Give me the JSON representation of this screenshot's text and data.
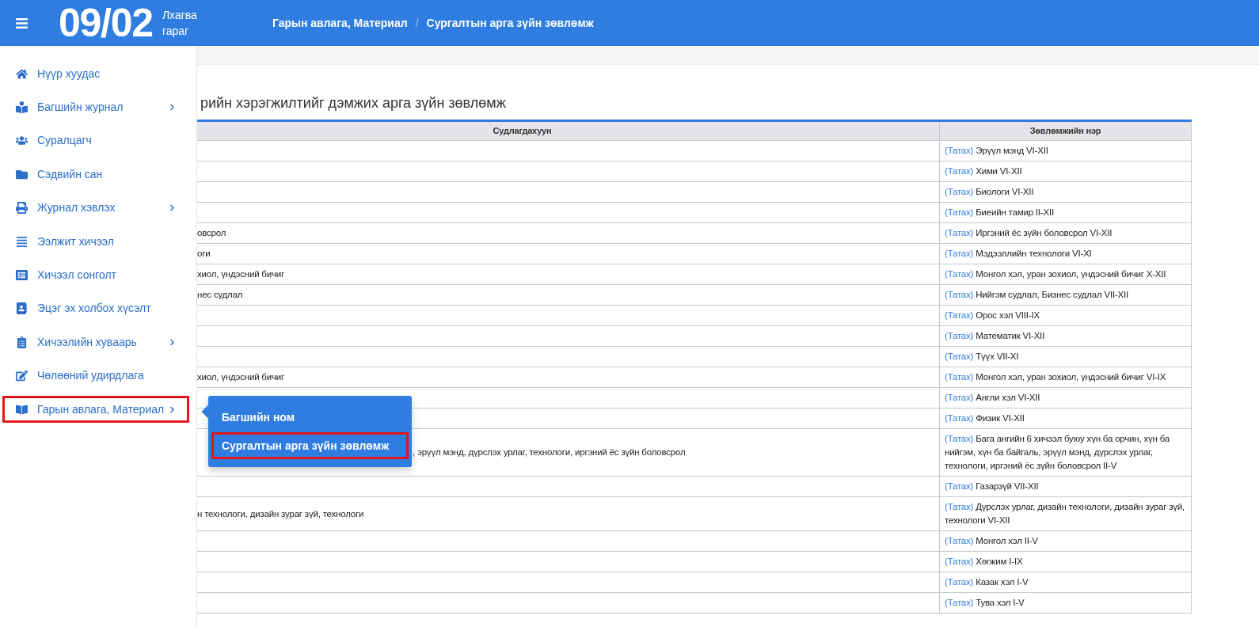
{
  "header": {
    "date": "09/02",
    "weekday_line1": "Лхагва",
    "weekday_line2": "гараг",
    "breadcrumb": [
      "Гарын авлага, Материал",
      "Сургалтын арга зүйн зөвлөмж"
    ],
    "breadcrumb_separator": "/"
  },
  "sidebar": {
    "items": [
      {
        "label": "Нүүр хуудас",
        "has_submenu": false,
        "highlighted": false
      },
      {
        "label": "Багшийн журнал",
        "has_submenu": true,
        "highlighted": false
      },
      {
        "label": "Суралцагч",
        "has_submenu": false,
        "highlighted": false
      },
      {
        "label": "Сэдвийн сан",
        "has_submenu": false,
        "highlighted": false
      },
      {
        "label": "Журнал хэвлэх",
        "has_submenu": true,
        "highlighted": false
      },
      {
        "label": "Ээлжит хичээл",
        "has_submenu": false,
        "highlighted": false
      },
      {
        "label": "Хичээл сонголт",
        "has_submenu": false,
        "highlighted": false
      },
      {
        "label": "Эцэг эх холбох хүсэлт",
        "has_submenu": false,
        "highlighted": false
      },
      {
        "label": "Хичээлийн хуваарь",
        "has_submenu": true,
        "highlighted": false
      },
      {
        "label": "Чөлөөний удирдлага",
        "has_submenu": false,
        "highlighted": false
      },
      {
        "label": "Гарын авлага, Материал",
        "has_submenu": true,
        "highlighted": true
      }
    ]
  },
  "submenu": {
    "items": [
      {
        "label": "Багшийн ном",
        "highlighted": false
      },
      {
        "label": "Сургалтын арга зүйн зөвлөмж",
        "highlighted": true
      }
    ]
  },
  "page_title": "рийн хэрэгжилтийг дэмжих арга зүйн зөвлөмж",
  "table": {
    "columns": [
      "Судлагдахуун",
      "Зөвлөмжийн нэр"
    ],
    "rows": [
      {
        "link": "(Татах)",
        "name": "Эрүүл мэнд VI-XII"
      },
      {
        "link": "(Татах)",
        "name": "Хими VI-XII"
      },
      {
        "link": "(Татах)",
        "name": "Биологи VI-XII"
      },
      {
        "link": "(Татах)",
        "name": "Биеийн тамир II-XII"
      },
      {
        "subject": "овсрол",
        "link": "(Татах)",
        "name": "Иргэний ёс зүйн боловсрол VI-XII"
      },
      {
        "subject": "оги",
        "link": "(Татах)",
        "name": "Мэдээллийн технологи VI-XI"
      },
      {
        "subject": "хиол, үндэсний бичиг",
        "link": "(Татах)",
        "name": "Монгол хэл, уран зохиол, үндэсний бичиг X-XII"
      },
      {
        "subject": "нес судлал",
        "link": "(Татах)",
        "name": "Нийгэм судлал, Бизнес судлал VII-XII"
      },
      {
        "link": "(Татах)",
        "name": "Орос хэл VIII-IX"
      },
      {
        "link": "(Татах)",
        "name": "Математик VI-XII"
      },
      {
        "link": "(Татах)",
        "name": "Түүх VII-XI"
      },
      {
        "subject": "хиол, үндэсний бичиг",
        "link": "(Татах)",
        "name": "Монгол хэл, уран зохиол, үндэсний бичиг VI-IX"
      },
      {
        "link": "(Татах)",
        "name": "Англи хэл VI-XII"
      },
      {
        "link": "(Татах)",
        "name": "Физик VI-XII"
      },
      {
        "subject": ", эрүүл мэнд, дүрслэх урлаг, технологи, иргэний ёс зүйн боловсрол",
        "subject_covered": true,
        "link": "(Татах)",
        "name": "Бага ангийн 6 хичээл буюу хүн ба орчин, хүн ба нийгэм, хүн ба байгаль, эрүүл мэнд, дүрслэх урлаг, технологи, иргэний ёс зүйн боловсрол II-V"
      },
      {
        "link": "(Татах)",
        "name": "Газарзүй VII-XII"
      },
      {
        "subject": "н технологи, дизайн зураг зүй, технологи",
        "link": "(Татах)",
        "name": "Дүрслэх урлаг, дизайн технологи, дизайн зураг зүй, технологи VI-XII"
      },
      {
        "link": "(Татах)",
        "name": "Монгол хэл II-V"
      },
      {
        "link": "(Татах)",
        "name": "Хөгжим I-IX"
      },
      {
        "link": "(Татах)",
        "name": "Казак хэл I-V"
      },
      {
        "link": "(Татах)",
        "name": "Тува хэл I-V"
      }
    ]
  }
}
